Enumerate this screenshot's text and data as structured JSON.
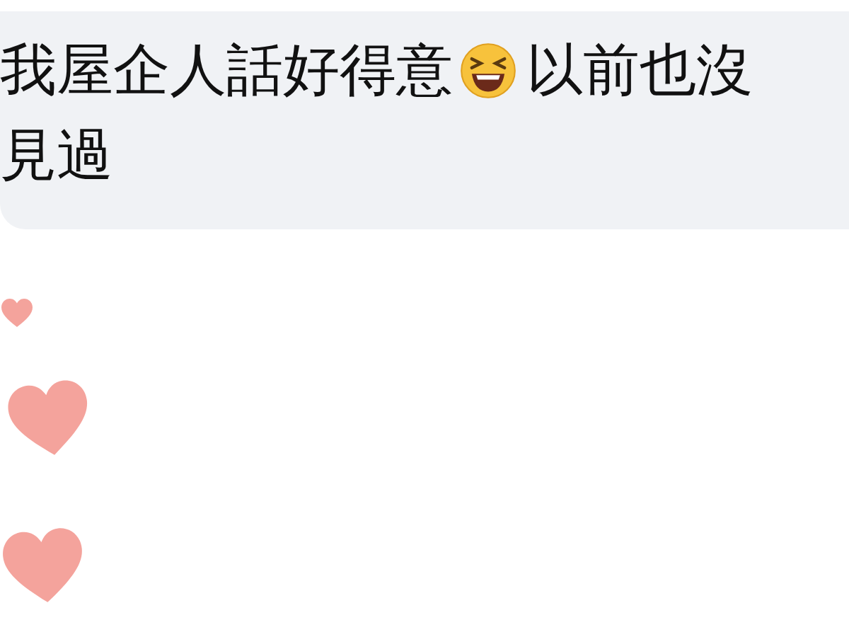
{
  "message": {
    "text_before": "我屋企人話好得意",
    "text_after": [
      "以前也沒",
      "見過"
    ]
  }
}
